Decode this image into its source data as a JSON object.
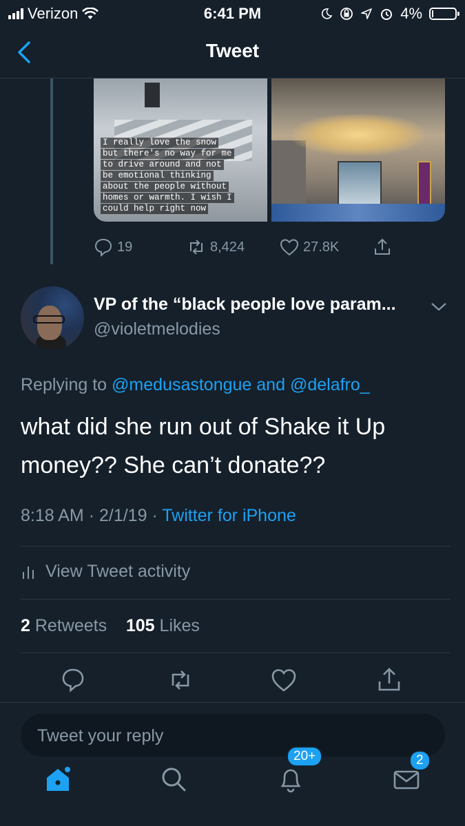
{
  "status_bar": {
    "carrier": "Verizon",
    "time": "6:41 PM",
    "battery": "4%"
  },
  "nav": {
    "title": "Tweet"
  },
  "quoted_media": {
    "story_lines": [
      "I really love the snow",
      "but there's no way for me",
      "to drive around and not",
      "be emotional thinking",
      "about the people without",
      "homes or warmth. I wish I",
      "could help right now"
    ]
  },
  "parent_actions": {
    "replies": "19",
    "retweets": "8,424",
    "likes": "27.8K"
  },
  "tweet": {
    "display_name": "VP of the “black people love param...",
    "handle": "@violetmelodies",
    "replying_prefix": "Replying to",
    "replying_user1": "@medusastongue",
    "replying_and": "and",
    "replying_user2": "@delafro_",
    "text": "what did she run out of Shake it Up money?? She can’t donate??",
    "time": "8:18 AM",
    "date": "2/1/19",
    "source": "Twitter for iPhone",
    "activity_label": "View Tweet activity",
    "retweets_count": "2",
    "retweets_label": "Retweets",
    "likes_count": "105",
    "likes_label": "Likes"
  },
  "reply": {
    "placeholder": "Tweet your reply"
  },
  "tab_bar": {
    "notifications_badge": "20+",
    "messages_badge": "2"
  },
  "colors": {
    "background": "#15202b",
    "accent": "#1da1f2",
    "secondary_text": "#8899a6"
  }
}
